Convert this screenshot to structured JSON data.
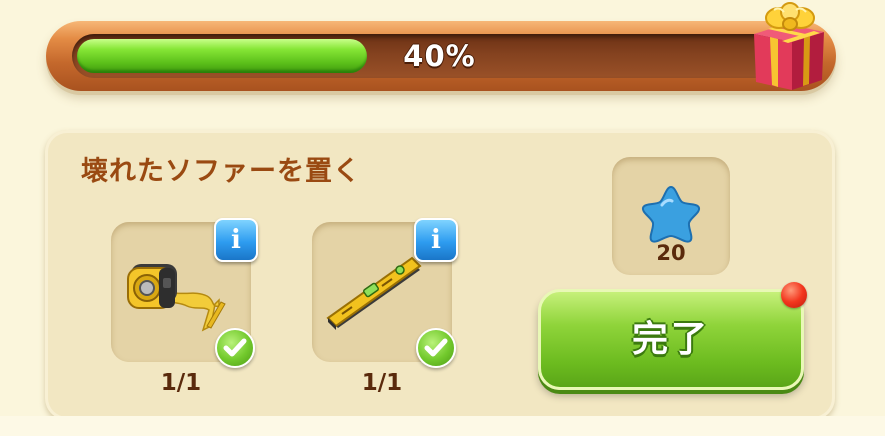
{
  "progress": {
    "label": "40%",
    "fraction": 0.4,
    "fill_color": "#6ccb24",
    "reward_icon": "gift-box-icon"
  },
  "task": {
    "title": "壊れたソファーを置く",
    "items": [
      {
        "icon": "tape-measure-icon",
        "count": "1/1",
        "completed": true,
        "info_label": "i"
      },
      {
        "icon": "spirit-level-icon",
        "count": "1/1",
        "completed": true,
        "info_label": "i"
      }
    ],
    "reward": {
      "icon": "blue-star-icon",
      "amount": "20",
      "color": "#3aa0e0"
    },
    "complete_button": {
      "label": "完了",
      "color": "#7ec82a",
      "has_notification": true
    }
  }
}
